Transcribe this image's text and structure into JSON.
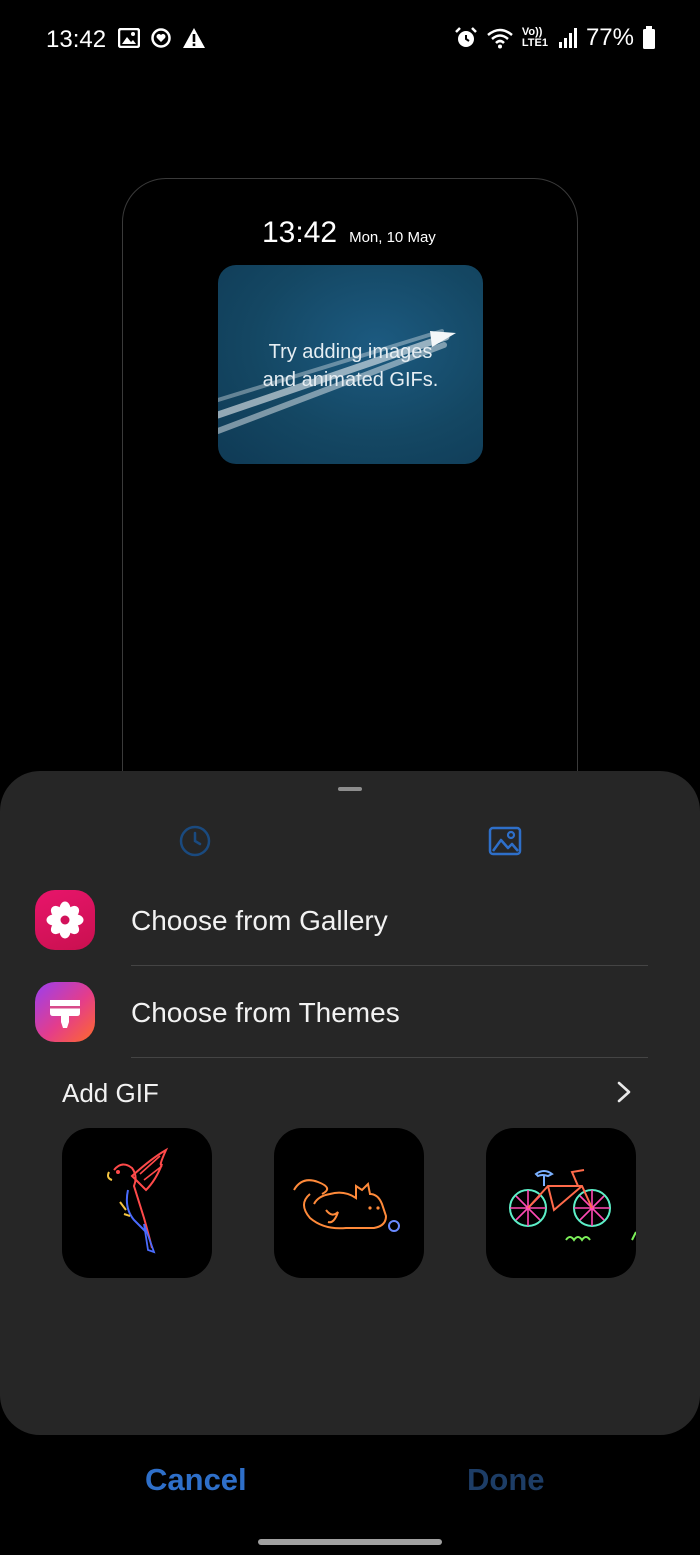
{
  "status_bar": {
    "time": "13:42",
    "left_icons": [
      "gallery-icon",
      "sync-icon",
      "warning-icon"
    ],
    "right_icons": [
      "alarm-icon",
      "wifi-icon",
      "lte-indicator",
      "signal-icon",
      "battery-icon"
    ],
    "volte_label": "Vo))",
    "lte_label": "LTE1",
    "battery_percent": "77%",
    "battery_level": 0.77
  },
  "preview": {
    "time": "13:42",
    "date": "Mon, 10 May",
    "card_text": "Try adding images\nand animated GIFs.",
    "card_color": "#144763"
  },
  "sheet": {
    "tabs": [
      {
        "name": "clock-tab",
        "icon": "clock-icon",
        "selected": false
      },
      {
        "name": "image-tab",
        "icon": "image-icon",
        "selected": true
      }
    ],
    "options": [
      {
        "label": "Choose from Gallery",
        "icon": "gallery-flower-icon",
        "color": "#e8156b"
      },
      {
        "label": "Choose from Themes",
        "icon": "themes-brush-icon",
        "color": "#c43ec4"
      }
    ],
    "gif_section": {
      "title": "Add GIF",
      "thumbnails": [
        {
          "name": "parrot-gif",
          "icon": "parrot-icon"
        },
        {
          "name": "cat-gif",
          "icon": "cat-icon"
        },
        {
          "name": "bicycle-gif",
          "icon": "bicycle-icon"
        }
      ]
    }
  },
  "buttons": {
    "cancel": "Cancel",
    "done": "Done"
  },
  "colors": {
    "accent": "#2e6fc9",
    "disabled": "#1d3d66",
    "sheet_bg": "#262626"
  }
}
